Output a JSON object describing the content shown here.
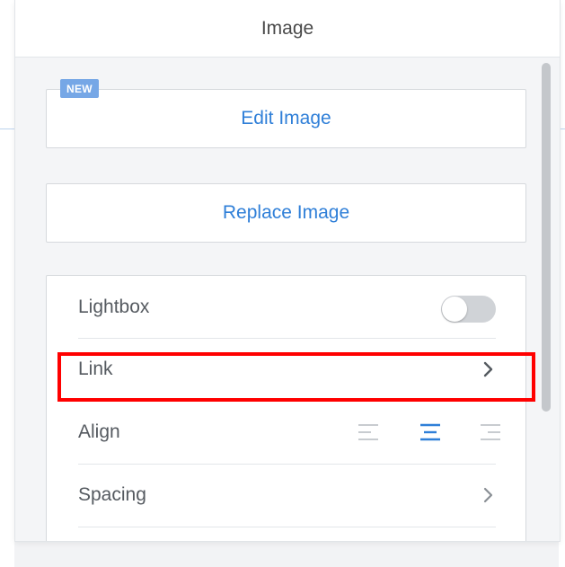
{
  "panel": {
    "title": "Image"
  },
  "badge": {
    "label": "NEW"
  },
  "buttons": {
    "edit_image": "Edit Image",
    "replace_image": "Replace Image"
  },
  "settings": {
    "rows": [
      {
        "label": "Lightbox",
        "control": "toggle",
        "toggle_on": false
      },
      {
        "label": "Link",
        "control": "chevron-right-icon"
      },
      {
        "label": "Align",
        "control": "align-buttons",
        "options": [
          "align-left-icon",
          "align-center-icon",
          "align-right-icon"
        ],
        "selected": "align-center-icon"
      },
      {
        "label": "Spacing",
        "control": "chevron-right-icon"
      }
    ]
  },
  "colors": {
    "accent": "#2f7fd8",
    "badge": "#76a7e6",
    "highlight": "#ff0000",
    "toggle_off": "#d0d3d7"
  }
}
